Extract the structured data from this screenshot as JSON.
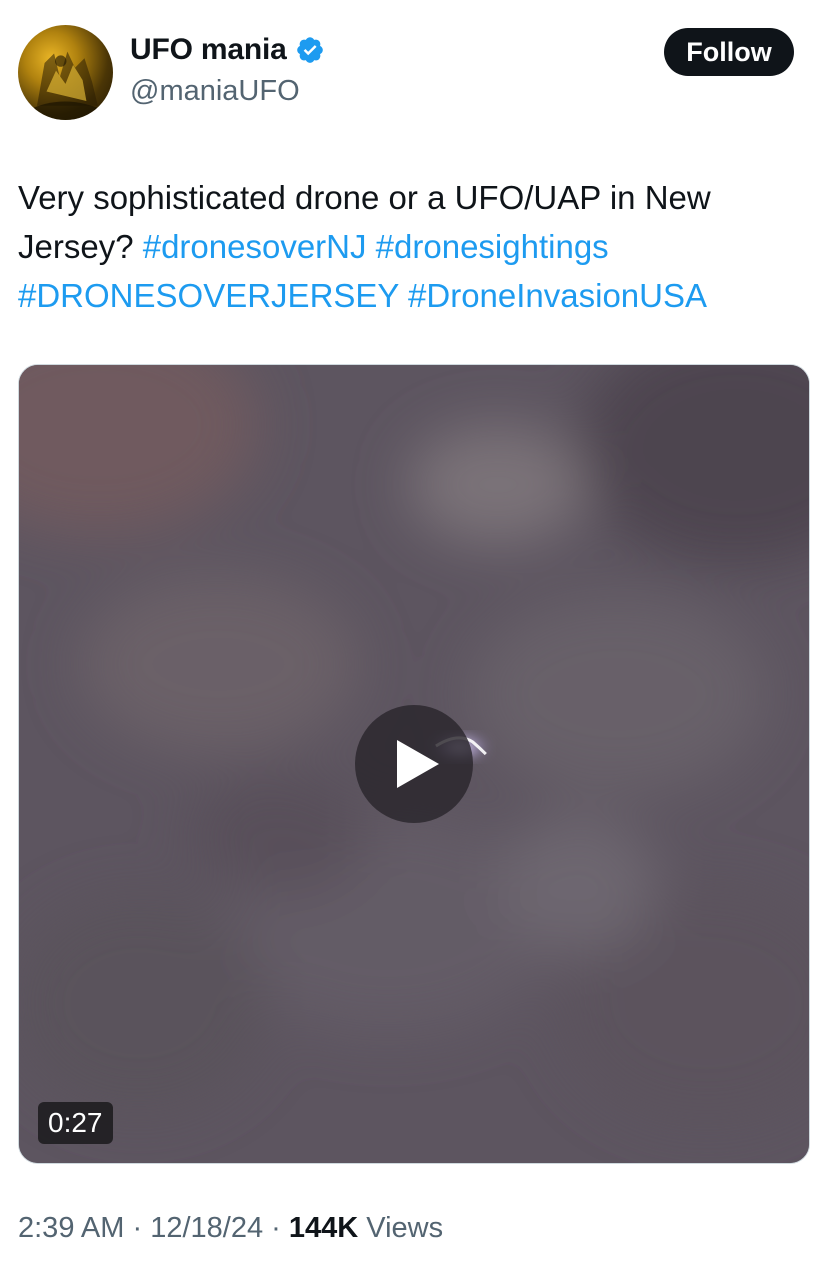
{
  "author": {
    "display_name": "UFO mania",
    "handle": "@maniaUFO",
    "verified": true,
    "avatar_icon": "golden-figure-avatar"
  },
  "follow_button": {
    "label": "Follow"
  },
  "tweet": {
    "text_plain": "Very sophisticated drone or a UFO/UAP in New Jersey? ",
    "hashtags": [
      "#dronesoverNJ",
      "#dronesightings",
      "#DRONESOVERJERSEY",
      "#DroneInvasionUSA"
    ]
  },
  "video": {
    "duration": "0:27",
    "play_icon": "play-icon"
  },
  "meta": {
    "time": "2:39 AM",
    "separator": "·",
    "date": "12/18/24",
    "views_count": "144K",
    "views_label": "Views"
  },
  "colors": {
    "link": "#1d9bf0",
    "secondary_text": "#536471",
    "primary_text": "#0f1419",
    "verified_badge": "#1d9bf0",
    "follow_bg": "#0f1419"
  }
}
